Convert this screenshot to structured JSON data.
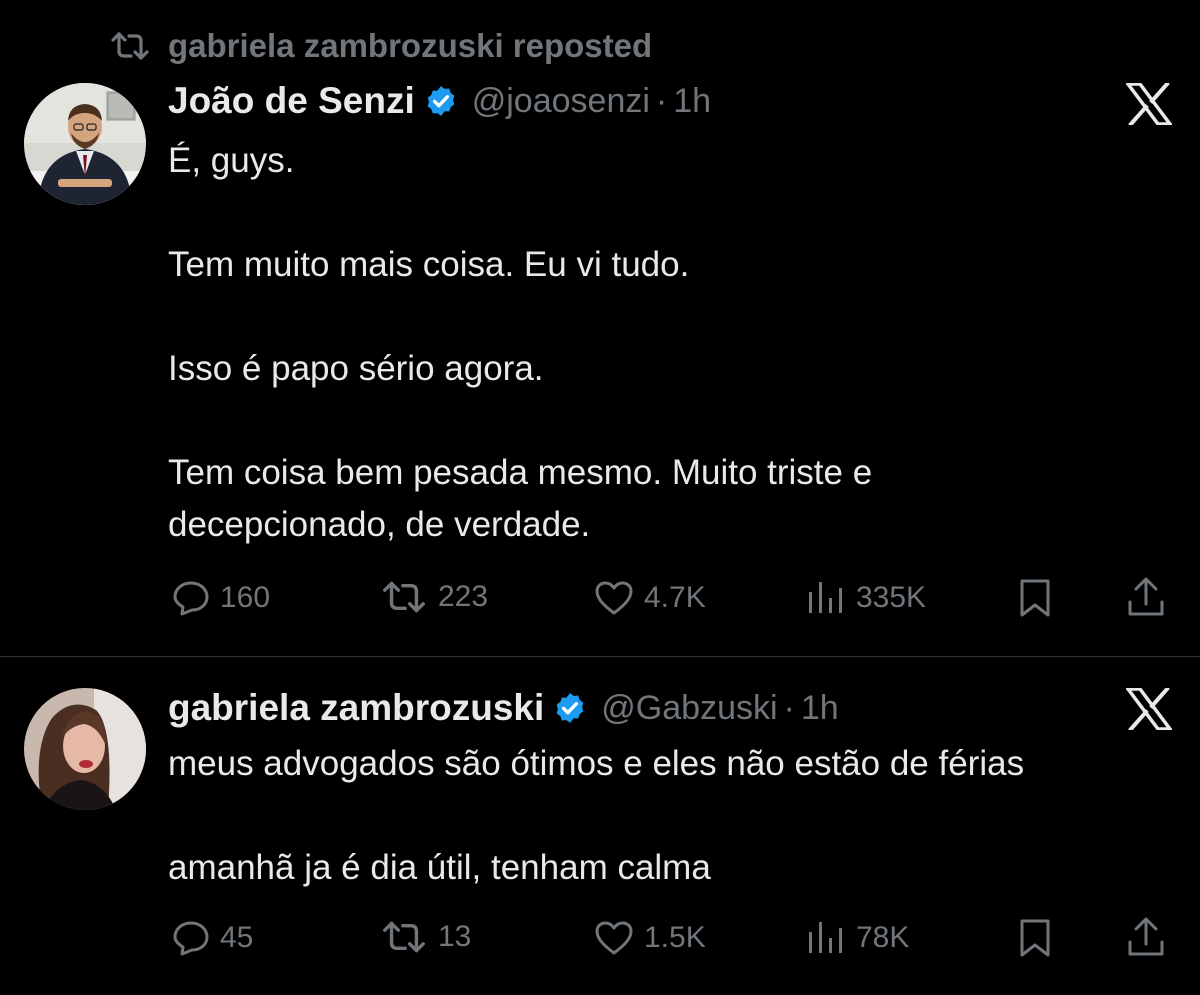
{
  "repost_banner": {
    "text": "gabriela zambrozuski reposted"
  },
  "tweets": [
    {
      "name": "João de Senzi",
      "handle": "@joaosenzi",
      "separator": "·",
      "time": "1h",
      "text": "É, guys.\n\nTem muito mais coisa. Eu vi tudo.\n\nIsso é papo sério agora.\n\nTem coisa bem pesada mesmo. Muito triste e\ndecepcionado, de verdade.",
      "stats": {
        "replies": "160",
        "reposts": "223",
        "likes": "4.7K",
        "views": "335K"
      }
    },
    {
      "name": "gabriela zambrozuski",
      "handle": "@Gabzuski",
      "separator": "·",
      "time": "1h",
      "text": "meus advogados são ótimos e eles não estão de férias\n\namanhã ja é dia útil, tenham calma",
      "stats": {
        "replies": "45",
        "reposts": "13",
        "likes": "1.5K",
        "views": "78K"
      }
    }
  ],
  "icons": {
    "repost": "repost-icon",
    "verified": "verified-badge-icon",
    "x": "x-logo-icon",
    "reply": "reply-icon",
    "like": "heart-icon",
    "views": "views-icon",
    "bookmark": "bookmark-icon",
    "share": "share-icon"
  },
  "colors": {
    "background": "#000000",
    "text": "#e7e9ea",
    "muted": "#71767b",
    "verified": "#1d9bf0",
    "divider": "#2f3336"
  }
}
